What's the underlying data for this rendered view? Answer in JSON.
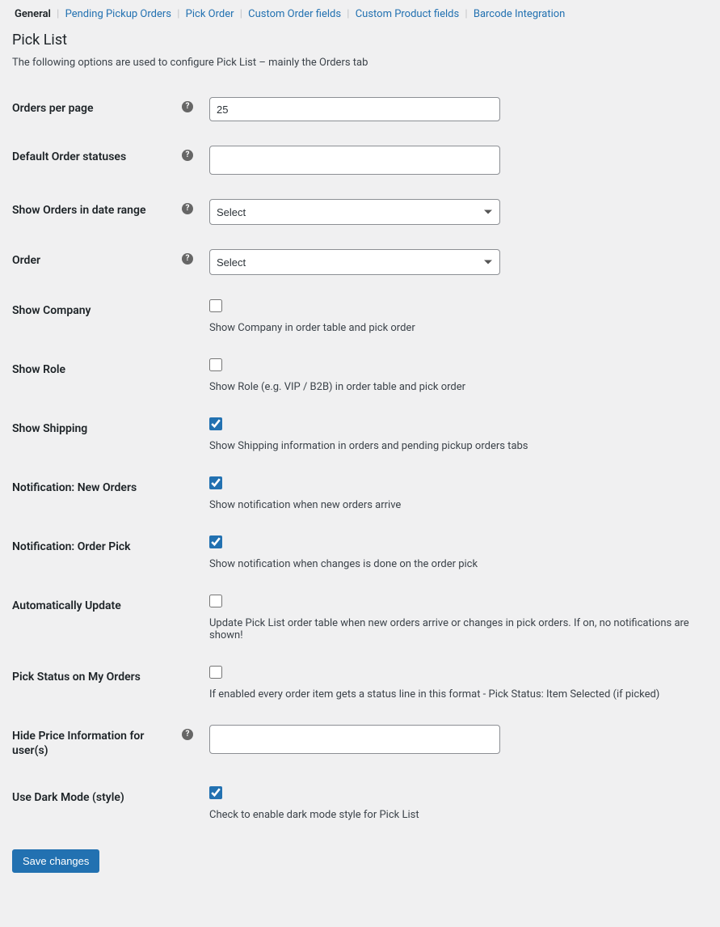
{
  "tabs": {
    "general": "General",
    "pending_pickup": "Pending Pickup Orders",
    "pick_order": "Pick Order",
    "custom_order_fields": "Custom Order fields",
    "custom_product_fields": "Custom Product fields",
    "barcode": "Barcode Integration"
  },
  "section": {
    "title": "Pick List",
    "description": "The following options are used to configure Pick List – mainly the Orders tab"
  },
  "fields": {
    "orders_per_page": {
      "label": "Orders per page",
      "value": "25"
    },
    "default_order_statuses": {
      "label": "Default Order statuses",
      "value": ""
    },
    "show_orders_date_range": {
      "label": "Show Orders in date range",
      "placeholder": "Select"
    },
    "order": {
      "label": "Order",
      "placeholder": "Select"
    },
    "show_company": {
      "label": "Show Company",
      "desc": "Show Company in order table and pick order"
    },
    "show_role": {
      "label": "Show Role",
      "desc": "Show Role (e.g. VIP / B2B) in order table and pick order"
    },
    "show_shipping": {
      "label": "Show Shipping",
      "desc": "Show Shipping information in orders and pending pickup orders tabs"
    },
    "notif_new_orders": {
      "label": "Notification: New Orders",
      "desc": "Show notification when new orders arrive"
    },
    "notif_order_pick": {
      "label": "Notification: Order Pick",
      "desc": "Show notification when changes is done on the order pick"
    },
    "auto_update": {
      "label": "Automatically Update",
      "desc": "Update Pick List order table when new orders arrive or changes in pick orders. If on, no notifications are shown!"
    },
    "pick_status_my_orders": {
      "label": "Pick Status on My Orders",
      "desc": "If enabled every order item gets a status line in this format - Pick Status: Item Selected (if picked)"
    },
    "hide_price_info": {
      "label": "Hide Price Information for user(s)",
      "value": ""
    },
    "dark_mode": {
      "label": "Use Dark Mode (style)",
      "desc": "Check to enable dark mode style for Pick List"
    }
  },
  "buttons": {
    "save": "Save changes"
  }
}
